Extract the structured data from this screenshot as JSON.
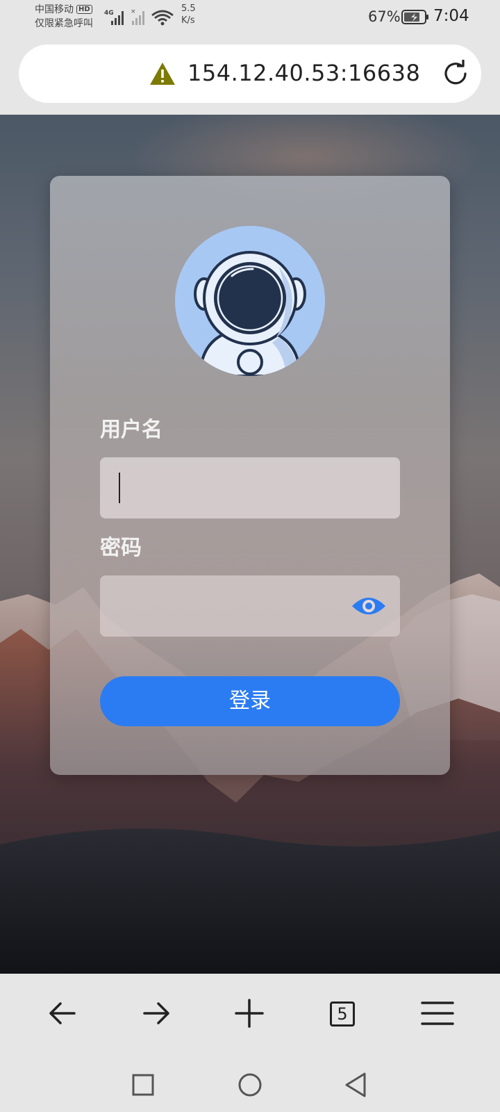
{
  "status_bar": {
    "carrier_line1": "中国移动",
    "hd_badge": "HD",
    "carrier_line2": "仅限紧急呼叫",
    "network": "4G",
    "speed_value": "5.5",
    "speed_unit": "K/s",
    "battery_percent": "67%",
    "time": "7:04"
  },
  "address_bar": {
    "security_icon": "warning-triangle-icon",
    "url": "154.12.40.53:16638",
    "reload_icon": "reload-icon"
  },
  "login_form": {
    "avatar_icon": "astronaut-icon",
    "username_label": "用户名",
    "username_value": "",
    "password_label": "密码",
    "password_value": "",
    "toggle_visibility_icon": "eye-icon",
    "submit_label": "登录",
    "accent_color": "#2b7cf2"
  },
  "toolbar": {
    "back_icon": "arrow-left-icon",
    "forward_icon": "arrow-right-icon",
    "new_tab_icon": "plus-icon",
    "tabs_count": "5",
    "menu_icon": "hamburger-menu-icon"
  },
  "navbar": {
    "recents_icon": "square-icon",
    "home_icon": "circle-icon",
    "back_icon": "triangle-back-icon"
  }
}
